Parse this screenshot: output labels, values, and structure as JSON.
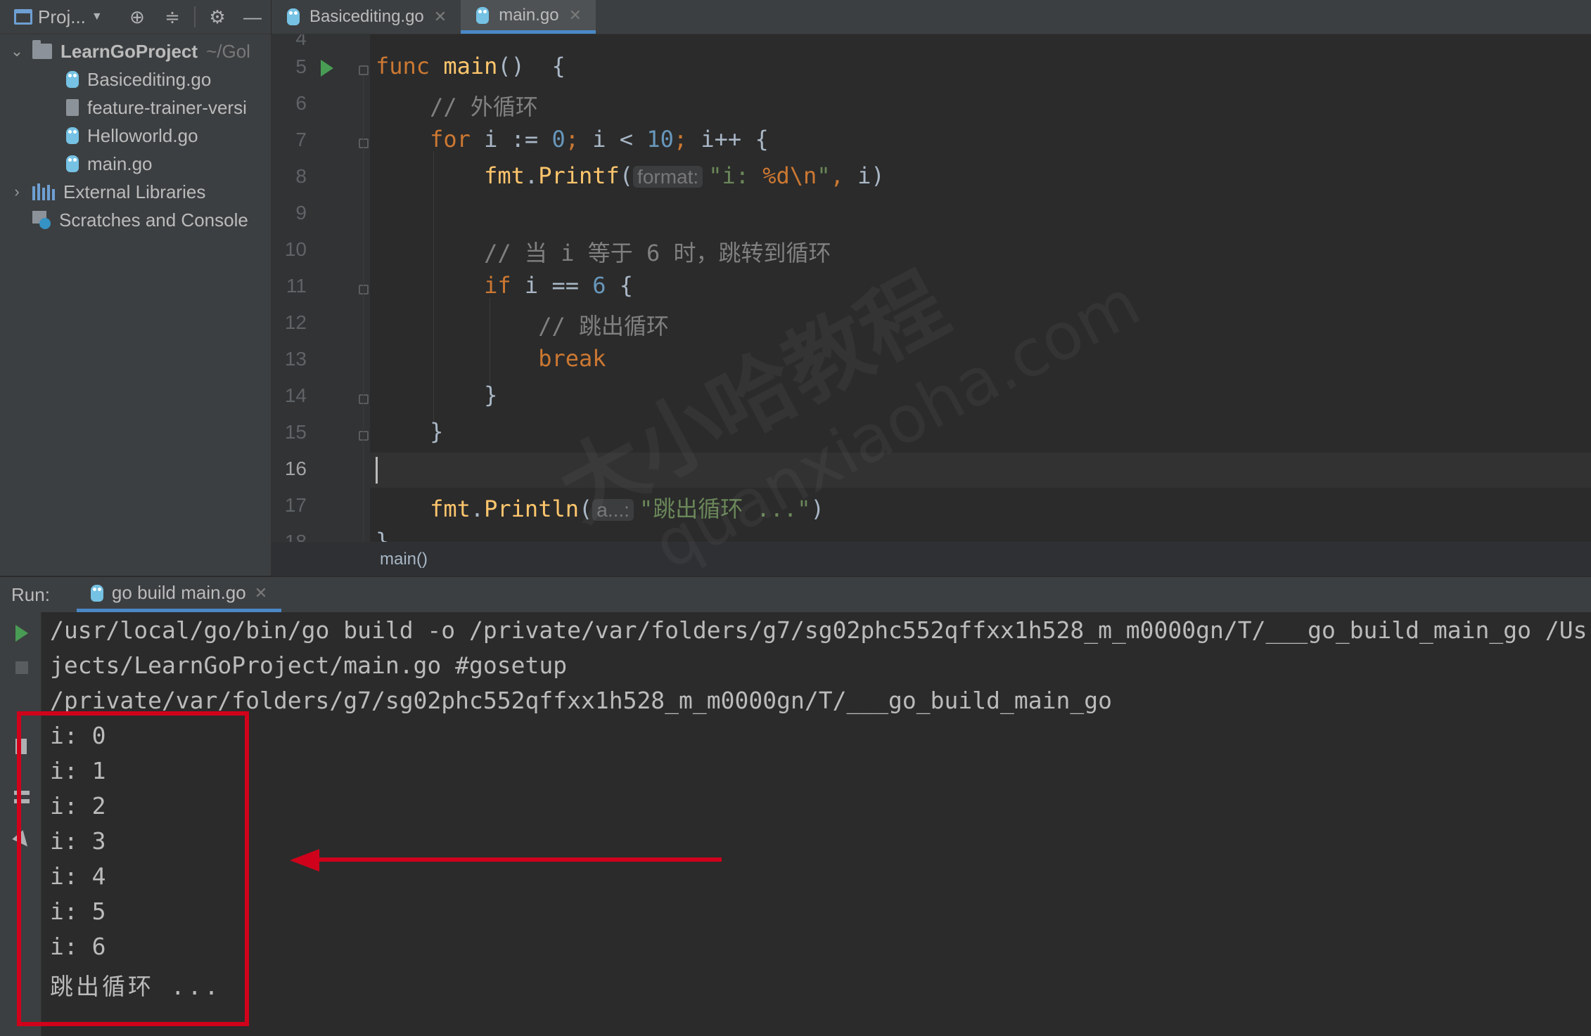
{
  "toolbar": {
    "project_label": "Proj...",
    "icons": [
      "project-icon",
      "chevron-down-icon",
      "locate-icon",
      "collapse-all-icon",
      "gear-icon",
      "minimize-icon"
    ]
  },
  "tabs": [
    {
      "label": "Basicediting.go",
      "active": false
    },
    {
      "label": "main.go",
      "active": true
    }
  ],
  "project_tree": {
    "root": {
      "name": "LearnGoProject",
      "path": "~/Gol"
    },
    "files": [
      "Basicediting.go",
      "feature-trainer-versi",
      "Helloworld.go",
      "main.go"
    ],
    "external_libraries": "External Libraries",
    "scratches": "Scratches and Console"
  },
  "editor": {
    "line_numbers": [
      "4",
      "5",
      "6",
      "7",
      "8",
      "9",
      "10",
      "11",
      "12",
      "13",
      "14",
      "15",
      "16",
      "17",
      "18"
    ],
    "current_line": "16",
    "hint_format": "format:",
    "hint_a": "a...:",
    "comment_outer": "// 外循环",
    "comment_when": "// 当 i 等于 6 时，跳转到循环",
    "comment_break": "// 跳出循环",
    "println_string": "\"跳出循环 ...\"",
    "breadcrumb": "main()"
  },
  "run": {
    "label": "Run:",
    "tab": "go build main.go",
    "console_lines": [
      "/usr/local/go/bin/go build -o /private/var/folders/g7/sg02phc552qffxx1h528_m_m0000gn/T/___go_build_main_go /Us",
      "jects/LearnGoProject/main.go #gosetup",
      "/private/var/folders/g7/sg02phc552qffxx1h528_m_m0000gn/T/___go_build_main_go",
      "i: 0",
      "i: 1",
      "i: 2",
      "i: 3",
      "i: 4",
      "i: 5",
      "i: 6",
      "跳出循环 ..."
    ]
  },
  "watermark": {
    "main": "大小哈教程",
    "sub": "quanxiaoha.com"
  },
  "colors": {
    "keyword": "#cc7832",
    "function": "#ffc66d",
    "number": "#6897bb",
    "string": "#6a8759",
    "comment": "#808080",
    "annotation": "#d0021b",
    "accent": "#4a88c7"
  }
}
